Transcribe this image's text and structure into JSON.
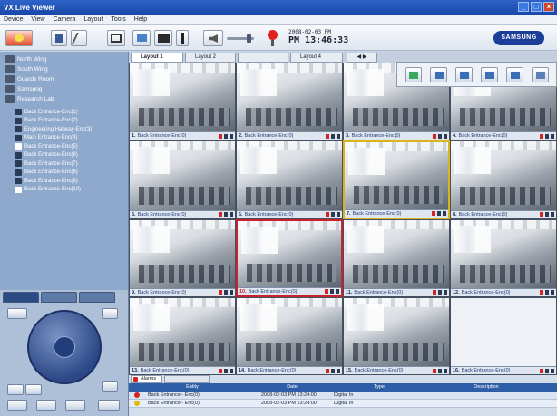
{
  "window": {
    "title": "VX Live Viewer"
  },
  "menu": [
    "Device",
    "View",
    "Camera",
    "Layout",
    "Tools",
    "Help"
  ],
  "clock": {
    "date": "2008-02-03 PM",
    "time": "PM 13:46:33"
  },
  "brand": "SAMSUNG",
  "tree": {
    "groups": [
      "North Wing",
      "South Wing",
      "Guards Room",
      "Samsung",
      "Research Lab"
    ],
    "cameras": [
      "Back Entrance-Enc(1)",
      "Back Entrance-Enc(2)",
      "Engineering Hallway-Enc(3)",
      "Main Entrance-Enc(4)",
      "Back Entrance-Enc(5)",
      "Back Entrance-Enc(6)",
      "Back Entrance-Enc(7)",
      "Back Entrance-Enc(8)",
      "Back Entrance-Enc(9)",
      "Back Entrance-Enc(10)"
    ]
  },
  "layout_tabs": [
    "Layout 1",
    "Layout 2",
    "",
    "Layout 4"
  ],
  "cells": [
    {
      "num": "1.",
      "name": "Back Entrance-Enc(0)"
    },
    {
      "num": "2.",
      "name": "Back Entrance-Enc(0)"
    },
    {
      "num": "3.",
      "name": "Back Entrance-Enc(0)"
    },
    {
      "num": "4.",
      "name": "Back Entrance-Enc(0)"
    },
    {
      "num": "5.",
      "name": "Back Entrance-Enc(0)"
    },
    {
      "num": "6.",
      "name": "Back Entrance-Enc(0)"
    },
    {
      "num": "7.",
      "name": "Back Entrance-Enc(0)"
    },
    {
      "num": "8.",
      "name": "Back Entrance-Enc(0)"
    },
    {
      "num": "9.",
      "name": "Back Entrance-Enc(0)"
    },
    {
      "num": "10.",
      "name": "Back Entrance-Enc(0)"
    },
    {
      "num": "11.",
      "name": "Back Entrance-Enc(0)"
    },
    {
      "num": "12.",
      "name": "Back Entrance-Enc(0)"
    },
    {
      "num": "13.",
      "name": "Back Entrance-Enc(0)"
    },
    {
      "num": "14.",
      "name": "Back Entrance-Enc(0)"
    },
    {
      "num": "15.",
      "name": "Back Entrance-Enc(0)"
    },
    {
      "num": "16.",
      "name": "Back Entrance-Enc(0)"
    }
  ],
  "alarm": {
    "tabs": [
      "Alarms",
      ""
    ],
    "columns": [
      "Entity",
      "Date",
      "Type",
      "Description"
    ],
    "rows": [
      {
        "entity": "Back Entrance - Enc(0)",
        "date": "2008-02-03 PM 13:24:00",
        "type": "Digital In",
        "desc": ""
      },
      {
        "entity": "Back Entrance - Enc(0)",
        "date": "2008-02-03 PM 13:24:00",
        "type": "Digital In",
        "desc": ""
      }
    ]
  }
}
